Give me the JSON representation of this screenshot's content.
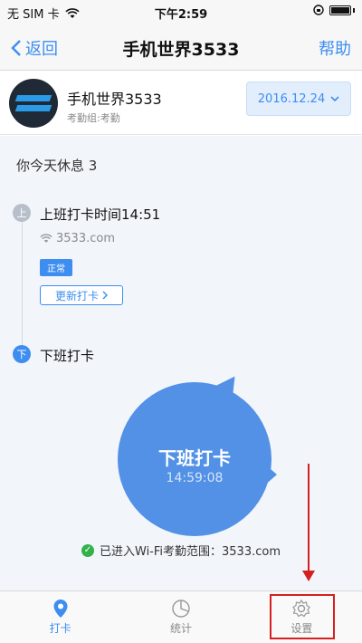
{
  "status_bar": {
    "carrier": "无 SIM 卡",
    "time": "下午2:59"
  },
  "nav": {
    "back_label": "返回",
    "title": "手机世界3533",
    "help_label": "帮助"
  },
  "profile": {
    "name": "手机世界3533",
    "group": "考勤组:考勤",
    "date": "2016.12.24"
  },
  "main": {
    "rest_text": "你今天休息 3",
    "checkin": {
      "title": "上班打卡时间14:51",
      "wifi": "3533.com",
      "status": "正常",
      "update_label": "更新打卡"
    },
    "checkout": {
      "title": "下班打卡",
      "button_label": "下班打卡",
      "time": "14:59:08"
    },
    "wifi_range": "已进入Wi-Fi考勤范围：3533.com"
  },
  "tabs": [
    {
      "label": "打卡",
      "icon": "location-pin-icon"
    },
    {
      "label": "统计",
      "icon": "pie-chart-icon"
    },
    {
      "label": "设置",
      "icon": "gear-icon"
    }
  ],
  "colors": {
    "accent": "#3d8ef0",
    "button": "#5291e6",
    "annotation": "#d42020"
  }
}
